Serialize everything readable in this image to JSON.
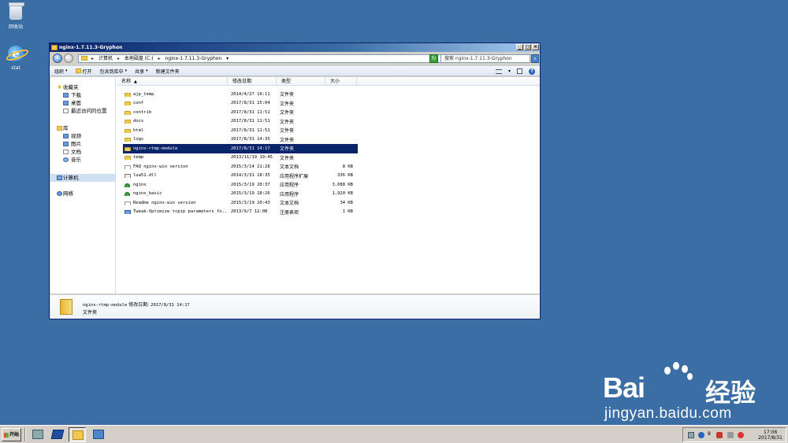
{
  "desktop": {
    "icons": [
      {
        "label": "回收站",
        "icon": "recycle-bin-icon"
      },
      {
        "label": "stat",
        "icon": "ie-icon"
      }
    ]
  },
  "window": {
    "title": "nginx-1.7.11.3-Gryphon",
    "controls": {
      "minimize": "_",
      "maximize": "□",
      "close": "×"
    },
    "address": {
      "crumbs": [
        "计算机",
        "本地磁盘 (C:)",
        "nginx-1.7.11.3-Gryphon"
      ],
      "separator": "▸",
      "dropdown": "▾"
    },
    "search": {
      "placeholder": "搜索 nginx-1.7.11.3-Gryphon"
    },
    "toolbar": {
      "organize": "组织",
      "open": "打开",
      "include_in_library": "包含到库中",
      "share": "共享",
      "new_folder": "新建文件夹",
      "arrow": "▾",
      "help": "?"
    },
    "nav": {
      "favorites": "收藏夹",
      "downloads": "下载",
      "desktop": "桌面",
      "recent": "最近访问的位置",
      "libraries": "库",
      "videos": "视频",
      "pictures": "图片",
      "documents": "文档",
      "music": "音乐",
      "computer": "计算机",
      "network": "网络"
    },
    "columns": {
      "name": "名称",
      "date": "修改日期",
      "type": "类型",
      "size": "大小",
      "sort": "▲"
    },
    "files": [
      {
        "name": "ajp_temp",
        "date": "2014/4/27 19:11",
        "type": "文件夹",
        "size": "",
        "icon": "folder"
      },
      {
        "name": "conf",
        "date": "2017/8/31 15:04",
        "type": "文件夹",
        "size": "",
        "icon": "folder"
      },
      {
        "name": "contrib",
        "date": "2017/8/31 11:51",
        "type": "文件夹",
        "size": "",
        "icon": "folder"
      },
      {
        "name": "docs",
        "date": "2017/8/31 11:51",
        "type": "文件夹",
        "size": "",
        "icon": "folder"
      },
      {
        "name": "html",
        "date": "2017/8/31 11:51",
        "type": "文件夹",
        "size": "",
        "icon": "folder"
      },
      {
        "name": "logs",
        "date": "2017/8/31 14:35",
        "type": "文件夹",
        "size": "",
        "icon": "folder"
      },
      {
        "name": "nginx-rtmp-module",
        "date": "2017/8/31 14:17",
        "type": "文件夹",
        "size": "",
        "icon": "folder",
        "selected": true
      },
      {
        "name": "temp",
        "date": "2013/11/19 19:45",
        "type": "文件夹",
        "size": "",
        "icon": "folder"
      },
      {
        "name": "FAQ nginx-win version",
        "date": "2015/3/14 21:28",
        "type": "文本文档",
        "size": "8 KB",
        "icon": "text"
      },
      {
        "name": "lua51.dll",
        "date": "2014/3/31 18:35",
        "type": "应用程序扩展",
        "size": "336 KB",
        "icon": "dll"
      },
      {
        "name": "nginx",
        "date": "2015/3/19 20:37",
        "type": "应用程序",
        "size": "3,088 KB",
        "icon": "exe"
      },
      {
        "name": "nginx_basic",
        "date": "2015/3/19 18:26",
        "type": "应用程序",
        "size": "1,920 KB",
        "icon": "exe"
      },
      {
        "name": "Readme nginx-win version",
        "date": "2015/3/19 20:43",
        "type": "文本文档",
        "size": "34 KB",
        "icon": "text"
      },
      {
        "name": "Tweak-Optimize tcpip parameters fo...",
        "date": "2013/9/7 12:08",
        "type": "注册表项",
        "size": "1 KB",
        "icon": "reg"
      }
    ],
    "details": {
      "name": "nginx-rtmp-module",
      "date_label": "修改日期:",
      "date": "2017/8/31 14:17",
      "type": "文件夹"
    }
  },
  "watermark": {
    "bai": "Bai",
    "du": "du",
    "cn": "经验",
    "url": "jingyan.baidu.com"
  },
  "taskbar": {
    "start": "开始",
    "ime": "8",
    "time": "17:06",
    "date": "2017/8/31"
  }
}
